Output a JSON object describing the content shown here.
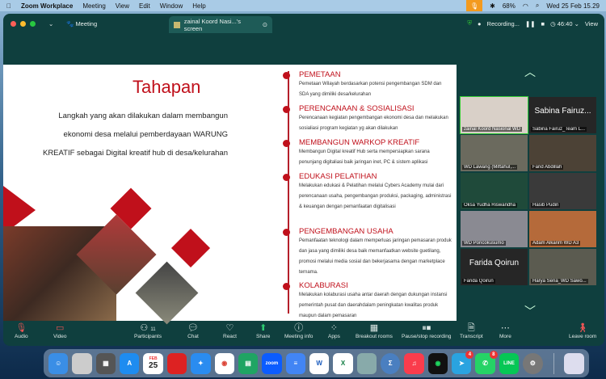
{
  "menubar": {
    "app": "Zoom Workplace",
    "items": [
      "Meeting",
      "View",
      "Edit",
      "Window",
      "Help"
    ],
    "battery": "68%",
    "datetime": "Wed 25 Feb  15.29"
  },
  "titlebar": {
    "meeting": "Meeting",
    "share_tab": "zainal Koord Nasi...'s screen",
    "recording": "Recording...",
    "timer": "46:40",
    "view": "View"
  },
  "slide": {
    "title": "Tahapan",
    "intro": "Langkah yang akan dilakukan dalam membangun ekonomi desa melalui pemberdayaan  WARUNG KREATIF sebagai Digital kreatif hub di desa/kelurahan",
    "sections": [
      {
        "h": "PEMETAAN",
        "p": "Pemetaan Wilayah berdasarkan potensi pengembangan SDM dan SDA yang dimiliki desa/kelurahan"
      },
      {
        "h": "PERENCANAAN & SOSIALISASI",
        "p": "Perencanaan kegiatan pengembangan ekonomi desa dan melakukan sosialiasi program kegiatan yg akan dilakukan"
      },
      {
        "h": "MEMBANGUN WARKOP KREATIF",
        "p": "Membangun Digital kreatif Hub serta mempersiapkan sarana penunjang digitaliasi baik jaringan inet, PC  & sistem aplikasi"
      },
      {
        "h": "EDUKASI PELATIHAN",
        "p": "Melakukan edukasi & Pelatihan melalui Cybers Academy mulai dari perencanaan usaha, pengembangan produksi, packaging,  administrasi & keuangan dengan pemanfaatan digitalisasi"
      },
      {
        "h": "PENGEMBANGAN USAHA",
        "p": "Pemanfaatan teknologi dalam memperluas jaringan pemasaran produk dan jasa yang dimiliki desa baik memanfaatkan website guetilang, promosi melalui media sosial dan bekerjasama dengan  marketplace ternama."
      },
      {
        "h": "KOLABURASI",
        "p": "Melakukan kolaburasi  usaha antar daerah dengan dukungan instansi pemerintah pusat dan daerahdalam peningkatan kwalitas produk maupun dalam pemasaran"
      }
    ]
  },
  "participants": [
    {
      "name": "zainal Koord Nasional WD",
      "bg": "#d9d0c8",
      "active": true
    },
    {
      "name": "Sabina Fairuz_Team L...",
      "big": "Sabina Fairuz...",
      "bg": "#262626"
    },
    {
      "name": "WD Lawang (Miftahul,...",
      "bg": "#6b6a5e"
    },
    {
      "name": "Farid Abdillah",
      "bg": "#4c4236"
    },
    {
      "name": "Oksa Yudha Riswandha",
      "bg": "#1f4a3a"
    },
    {
      "name": "Hasib Pudin",
      "bg": "#3a3a3a"
    },
    {
      "name": "WD Poncokusumo",
      "bg": "#8a8a92"
    },
    {
      "name": "Adam Alkarim WD A3",
      "bg": "#b56a3a"
    },
    {
      "name": "Farida Qoirun",
      "big": "Farida Qoirun",
      "bg": "#262626"
    },
    {
      "name": "Harya Sena_WD Sawo...",
      "bg": "#5b5b50"
    }
  ],
  "toolbar": {
    "audio": "Audio",
    "video": "Video",
    "participants": "Participants",
    "participants_count": "11",
    "chat": "Chat",
    "react": "React",
    "share": "Share",
    "meeting_info": "Meeting info",
    "apps": "Apps",
    "breakout": "Breakout rooms",
    "recording": "Pause/stop recording",
    "transcript": "Transcript",
    "more": "More",
    "leave": "Leave room"
  },
  "dock": {
    "calendar_month": "FEB",
    "calendar_day": "25",
    "zoom": "zoom",
    "telegram_badge": "4",
    "whatsapp_badge": "8",
    "line": "LINE"
  }
}
